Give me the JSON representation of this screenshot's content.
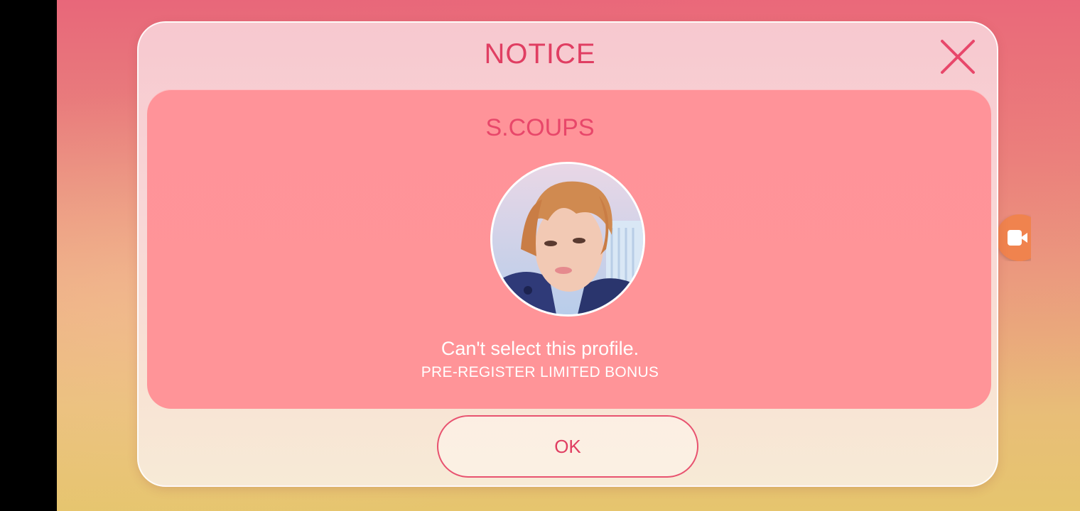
{
  "dialog": {
    "title": "NOTICE",
    "member_name": "S.COUPS",
    "message": "Can't select this profile.",
    "sub_message": "PRE-REGISTER LIMITED BONUS",
    "ok_label": "OK"
  },
  "icons": {
    "close": "close-icon",
    "screen_record": "video-camera-icon"
  },
  "colors": {
    "accent": "#e03e62",
    "panel": "#ff9399",
    "dialog_top": "#f7c8cf",
    "dialog_bottom": "#f7ead6",
    "record_bubble": "#f0834e"
  }
}
